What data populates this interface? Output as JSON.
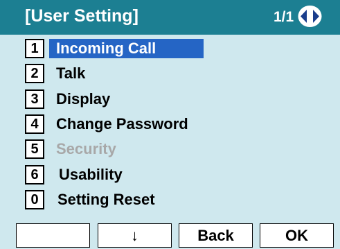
{
  "header": {
    "title": "[User Setting]",
    "page": "1/1",
    "nav_icon": "up-down-arrows-icon"
  },
  "menu": {
    "items": [
      {
        "number": "1",
        "label": "Incoming Call",
        "state": "selected"
      },
      {
        "number": "2",
        "label": "Talk",
        "state": "normal"
      },
      {
        "number": "3",
        "label": "Display",
        "state": "normal"
      },
      {
        "number": "4",
        "label": "Change Password",
        "state": "normal"
      },
      {
        "number": "5",
        "label": "Security",
        "state": "disabled"
      },
      {
        "number": "6",
        "label": "Usability",
        "state": "normal"
      },
      {
        "number": "0",
        "label": "Setting Reset",
        "state": "normal"
      }
    ]
  },
  "softkeys": {
    "key1": "",
    "key2": "↓",
    "key3": "Back",
    "key4": "OK"
  },
  "colors": {
    "header_bg": "#1c7f92",
    "screen_bg": "#cfe8ee",
    "selection_bg": "#2565c5",
    "disabled_text": "#a8a8a8"
  }
}
